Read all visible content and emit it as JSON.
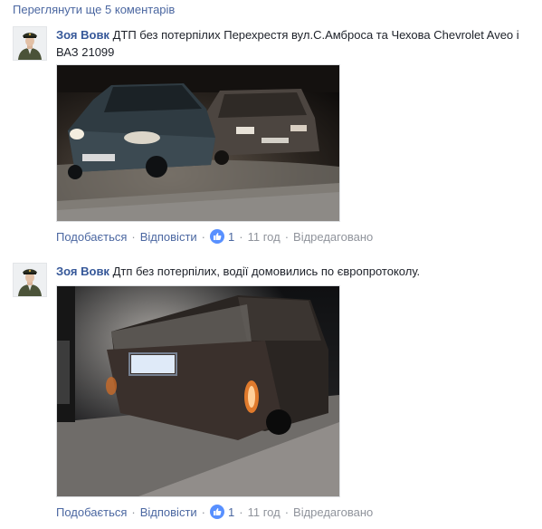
{
  "more_comments": "Переглянути ще 5 коментарів",
  "comments": [
    {
      "author": "Зоя Вовк",
      "text": "ДТП без потерпілих Перехрестя вул.С.Амброса та Чехова Chevrolet Aveo і ВАЗ 21099",
      "actions": {
        "like_label": "Подобається",
        "reply_label": "Відповісти",
        "like_count": "1",
        "time": "11 год",
        "edited": "Відредаговано"
      }
    },
    {
      "author": "Зоя Вовк",
      "text": "Дтп без потерпілих, водії домовились по європротоколу.",
      "actions": {
        "like_label": "Подобається",
        "reply_label": "Відповісти",
        "like_count": "1",
        "time": "11 год",
        "edited": "Відредаговано"
      }
    }
  ],
  "colors": {
    "link": "#4b67a1",
    "author": "#365899",
    "muted": "#90949c",
    "like_badge": "#5890ff"
  },
  "icons": {
    "like": "thumbs-up-icon",
    "avatar": "police-officer-avatar"
  }
}
